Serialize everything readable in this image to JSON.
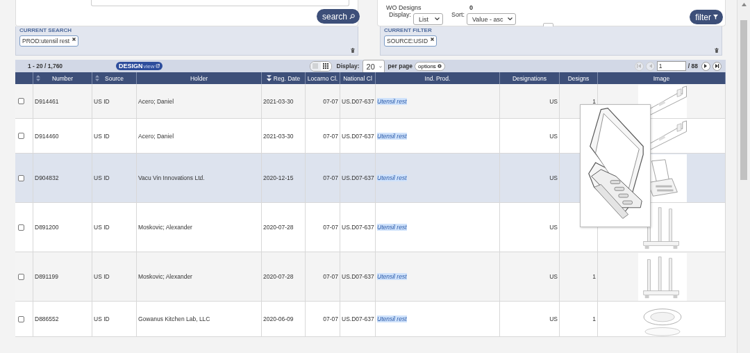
{
  "search_panel": {
    "button": "search"
  },
  "filter_panel": {
    "wo_designs_label": "WO Designs",
    "wo_designs_value": "0",
    "display_label": "Display:",
    "display_value": "List",
    "sort_label": "Sort:",
    "sort_value": "Value - asc",
    "button": "filter"
  },
  "current_search": {
    "title": "CURRENT SEARCH",
    "tags": [
      "PROD:utensil rest"
    ]
  },
  "current_filter": {
    "title": "CURRENT FILTER",
    "tags": [
      "SOURCE:USID"
    ]
  },
  "toolbar": {
    "range": "1 - 20 / 1,760",
    "design_view": {
      "main": "DESIGN",
      "sub": "view"
    },
    "views": [
      {
        "kind": "list",
        "selected": false
      },
      {
        "kind": "grid",
        "selected": true
      }
    ],
    "display_label": "Display:",
    "per_page": "20",
    "per_page_label": "per page",
    "options": "options",
    "pager": {
      "first_disabled": true,
      "prev_disabled": true,
      "page": "1",
      "total": "/ 88",
      "next_disabled": false,
      "last_disabled": false
    }
  },
  "table": {
    "columns": [
      {
        "label": "Number",
        "sortable": true,
        "sorted": false
      },
      {
        "label": "Source",
        "sortable": true,
        "sorted": false
      },
      {
        "label": "Holder",
        "sortable": false,
        "sorted": false
      },
      {
        "label": "Reg. Date",
        "sortable": true,
        "sorted": true
      },
      {
        "label": "Locarno Cl.",
        "sortable": false,
        "sorted": false
      },
      {
        "label": "National Cl",
        "sortable": false,
        "sorted": false
      },
      {
        "label": "Ind. Prod.",
        "sortable": false,
        "sorted": false
      },
      {
        "label": "Designations",
        "sortable": false,
        "sorted": false
      },
      {
        "label": "Designs",
        "sortable": false,
        "sorted": false
      },
      {
        "label": "Image",
        "sortable": false,
        "sorted": false
      }
    ],
    "rows": [
      {
        "checked": false,
        "highlighted": false,
        "number": "D914461",
        "source": "US ID",
        "holder": "Acero; Daniel",
        "reg_date": "2021-03-30",
        "locarno": "07-07",
        "national": "US.D07-637",
        "product": "Utensil rest",
        "designations": "US",
        "designs": "1",
        "image": {
          "kind": "rail"
        }
      },
      {
        "checked": false,
        "highlighted": false,
        "number": "D914460",
        "source": "US ID",
        "holder": "Acero; Daniel",
        "reg_date": "2021-03-30",
        "locarno": "07-07",
        "national": "US.D07-637",
        "product": "Utensil rest",
        "designations": "US",
        "image": {
          "kind": "rail"
        }
      },
      {
        "checked": false,
        "highlighted": true,
        "number": "D904832",
        "source": "US ID",
        "holder": "Vacu Vin Innovations Ltd.",
        "reg_date": "2020-12-15",
        "locarno": "07-07",
        "national": "US.D07-637",
        "product": "Utensil rest",
        "designations": "US",
        "image": {
          "kind": "stand"
        }
      },
      {
        "checked": false,
        "highlighted": false,
        "number": "D891200",
        "source": "US ID",
        "holder": "Moskovic; Alexander",
        "reg_date": "2020-07-28",
        "locarno": "07-07",
        "national": "US.D07-637",
        "product": "Utensil rest",
        "designations": "US",
        "image": {
          "kind": "rack"
        }
      },
      {
        "checked": false,
        "highlighted": false,
        "number": "D891199",
        "source": "US ID",
        "holder": "Moskovic; Alexander",
        "reg_date": "2020-07-28",
        "locarno": "07-07",
        "national": "US.D07-637",
        "product": "Utensil rest",
        "designations": "US",
        "designs": "1",
        "image": {
          "kind": "rack"
        }
      },
      {
        "checked": false,
        "highlighted": false,
        "number": "D886552",
        "source": "US ID",
        "holder": "Gowanus Kitchen Lab, LLC",
        "reg_date": "2020-06-09",
        "locarno": "07-07",
        "national": "US.D07-637",
        "product": "Utensil rest",
        "designations": "US",
        "designs": "1",
        "image": {
          "kind": "tray"
        }
      }
    ]
  }
}
